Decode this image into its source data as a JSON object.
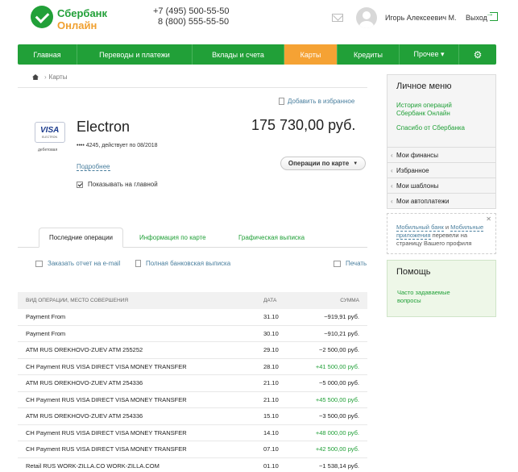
{
  "header": {
    "logo_line1": "Сбербанк",
    "logo_line2": "Онлайн",
    "phone1": "+7 (495) 500-55-50",
    "phone2": "8 (800) 555-55-50",
    "user_name": "Игорь Алексеевич М.",
    "logout_label": "Выход"
  },
  "nav": {
    "items": [
      "Главная",
      "Переводы и платежи",
      "Вклады и счета",
      "Карты",
      "Кредиты",
      "Прочее ▾"
    ],
    "active": "Карты",
    "gear_icon": "gear-icon"
  },
  "breadcrumb": {
    "current": "Карты"
  },
  "favorite_label": "Добавить в избранное",
  "card": {
    "brand": "VISA",
    "brand_sub": "ELECTRON",
    "type_label": "дебетовая",
    "name": "Electron",
    "number_info": "•••• 4245, действует по 08/2018",
    "balance": "175 730,00 руб.",
    "details_link": "Подробнее",
    "ops_button": "Операции по карте",
    "show_on_main_label": "Показывать на главной",
    "show_on_main_checked": true
  },
  "tabs": [
    "Последние операции",
    "Информация по карте",
    "Графическая выписка"
  ],
  "actions": {
    "email_report": "Заказать отчет на e-mail",
    "full_statement": "Полная банковская выписка",
    "print": "Печать"
  },
  "table": {
    "headers": [
      "Вид операции, место совершения",
      "Дата",
      "Сумма"
    ],
    "rows": [
      {
        "desc": "Payment From",
        "date": "31.10",
        "amount": "−919,91 руб.",
        "positive": false
      },
      {
        "desc": "Payment From",
        "date": "30.10",
        "amount": "−910,21 руб.",
        "positive": false
      },
      {
        "desc": "ATM RUS OREKHOVO-ZUEV ATM 255252",
        "date": "29.10",
        "amount": "−2 500,00 руб.",
        "positive": false
      },
      {
        "desc": "CH Payment RUS VISA DIRECT VISA MONEY TRANSFER",
        "date": "28.10",
        "amount": "+41 500,00 руб.",
        "positive": true
      },
      {
        "desc": "ATM RUS OREKHOVO-ZUEV ATM 254336",
        "date": "21.10",
        "amount": "−5 000,00 руб.",
        "positive": false
      },
      {
        "desc": "CH Payment RUS VISA DIRECT VISA MONEY TRANSFER",
        "date": "21.10",
        "amount": "+45 500,00 руб.",
        "positive": true
      },
      {
        "desc": "ATM RUS OREKHOVO-ZUEV ATM 254336",
        "date": "15.10",
        "amount": "−3 500,00 руб.",
        "positive": false
      },
      {
        "desc": "CH Payment RUS VISA DIRECT VISA MONEY TRANSFER",
        "date": "14.10",
        "amount": "+48 000,00 руб.",
        "positive": true
      },
      {
        "desc": "CH Payment RUS VISA DIRECT VISA MONEY TRANSFER",
        "date": "07.10",
        "amount": "+42 500,00 руб.",
        "positive": true
      },
      {
        "desc": "Retail RUS WORK-ZILLA.CO WORK-ZILLA.COM",
        "date": "01.10",
        "amount": "−1 538,14 руб.",
        "positive": false
      }
    ]
  },
  "sidebar": {
    "title": "Личное меню",
    "link_history_1": "История операций",
    "link_history_2": "Сбербанк Онлайн",
    "link_thanks": "Спасибо от Сбербанка",
    "items": [
      "Мои финансы",
      "Избранное",
      "Мои шаблоны",
      "Мои автоплатежи"
    ],
    "promo_link1": "Мобильный банк",
    "promo_and": " и ",
    "promo_link2": "Мобильные приложения",
    "promo_text": " перевели на страницу Вашего профиля",
    "help_title": "Помощь",
    "help_link": "Часто задаваемые вопросы"
  },
  "colors": {
    "brand_green": "#21a038",
    "active_orange": "#f5a234",
    "link_blue": "#4a7f9e"
  }
}
